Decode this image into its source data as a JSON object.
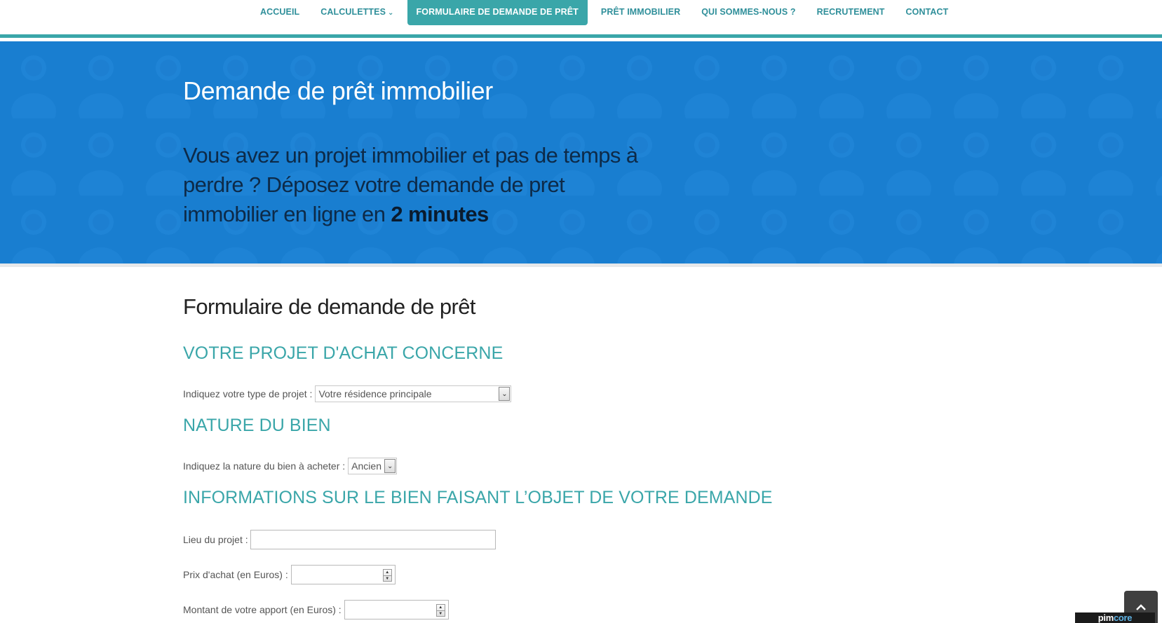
{
  "nav": {
    "items": [
      {
        "label": "ACCUEIL",
        "active": false
      },
      {
        "label": "CALCULETTES",
        "active": false,
        "dropdown": true
      },
      {
        "label": "FORMULAIRE DE DEMANDE DE PRÊT",
        "active": true
      },
      {
        "label": "PRÊT IMMOBILIER",
        "active": false
      },
      {
        "label": "QUI SOMMES-NOUS ?",
        "active": false
      },
      {
        "label": "RECRUTEMENT",
        "active": false
      },
      {
        "label": "CONTACT",
        "active": false
      }
    ],
    "accent_color": "#3aa6a9"
  },
  "hero": {
    "title": "Demande de prêt immobilier",
    "text": "Vous avez un projet immobilier et pas de temps à perdre ? Déposez votre demande de pret immobilier en ligne en ",
    "text_bold": "2 minutes",
    "background_color": "#1a7fd0"
  },
  "form": {
    "title": "Formulaire de demande de prêt",
    "sections": [
      {
        "title": "VOTRE PROJET D'ACHAT CONCERNE",
        "field_label": "Indiquez votre type de projet :",
        "field_value": "Votre résidence principale"
      },
      {
        "title": "NATURE DU BIEN",
        "field_label": "Indiquez la nature du bien à acheter :",
        "field_value": "Ancien"
      },
      {
        "title": "INFORMATIONS SUR LE BIEN FAISANT L’OBJET DE VOTRE DEMANDE",
        "fields": [
          {
            "label": "Lieu du projet :",
            "value": ""
          },
          {
            "label": "Prix d'achat (en Euros) :",
            "value": ""
          },
          {
            "label": "Montant de votre apport (en Euros) :",
            "value": ""
          }
        ]
      }
    ]
  },
  "footer": {
    "back_to_top_icon": "chevron-up-icon",
    "brand_part1": "pim",
    "brand_part2": "core"
  }
}
